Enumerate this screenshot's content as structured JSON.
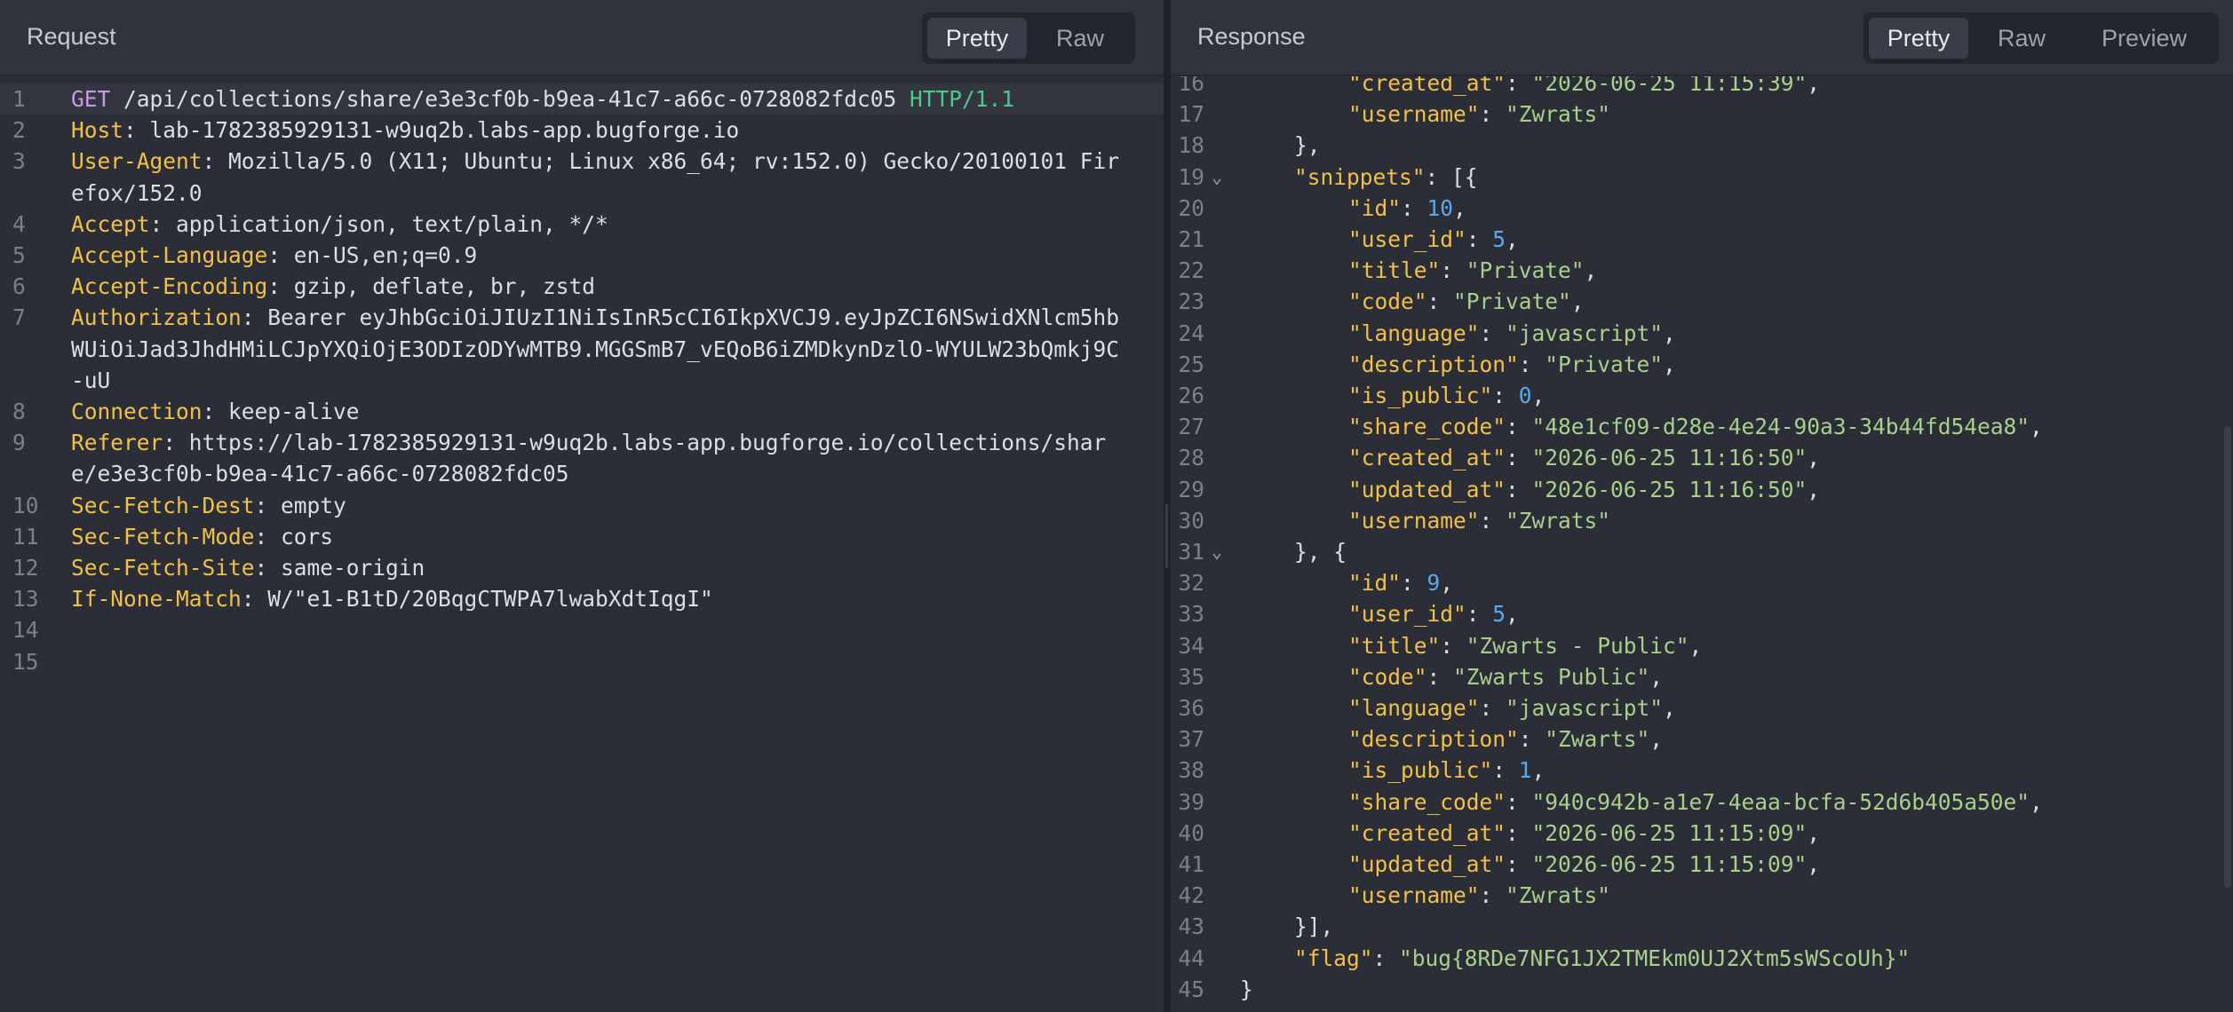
{
  "request": {
    "title": "Request",
    "tabs": [
      "Pretty",
      "Raw"
    ],
    "active_tab": "Pretty",
    "lines": [
      {
        "n": "1",
        "method": "GET",
        "path": " /api/collections/share/e3e3cf0b-b9ea-41c7-a66c-0728082fdc05 ",
        "proto": "HTTP/1.1"
      },
      {
        "n": "2",
        "key": "Host",
        "value": ": lab-1782385929131-w9uq2b.labs-app.bugforge.io"
      },
      {
        "n": "3",
        "key": "User-Agent",
        "value": ": Mozilla/5.0 (X11; Ubuntu; Linux x86_64; rv:152.0) Gecko/20100101 Fir",
        "cont": [
          "efox/152.0"
        ]
      },
      {
        "n": "4",
        "key": "Accept",
        "value": ": application/json, text/plain, */*"
      },
      {
        "n": "5",
        "key": "Accept-Language",
        "value": ": en-US,en;q=0.9"
      },
      {
        "n": "6",
        "key": "Accept-Encoding",
        "value": ": gzip, deflate, br, zstd"
      },
      {
        "n": "7",
        "key": "Authorization",
        "value": ": Bearer eyJhbGciOiJIUzI1NiIsInR5cCI6IkpXVCJ9.eyJpZCI6NSwidXNlcm5hb",
        "cont": [
          "WUiOiJad3JhdHMiLCJpYXQiOjE3ODIzODYwMTB9.MGGSmB7_vEQoB6iZMDkynDzlO-WYULW23bQmkj9C",
          "-uU"
        ]
      },
      {
        "n": "8",
        "key": "Connection",
        "value": ": keep-alive"
      },
      {
        "n": "9",
        "key": "Referer",
        "value": ": https://lab-1782385929131-w9uq2b.labs-app.bugforge.io/collections/shar",
        "cont": [
          "e/e3e3cf0b-b9ea-41c7-a66c-0728082fdc05"
        ]
      },
      {
        "n": "10",
        "key": "Sec-Fetch-Dest",
        "value": ": empty"
      },
      {
        "n": "11",
        "key": "Sec-Fetch-Mode",
        "value": ": cors"
      },
      {
        "n": "12",
        "key": "Sec-Fetch-Site",
        "value": ": same-origin"
      },
      {
        "n": "13",
        "key": "If-None-Match",
        "value": ": W/\"e1-B1tD/20BqgCTWPA7lwabXdtIqgI\""
      },
      {
        "n": "14"
      },
      {
        "n": "15"
      }
    ]
  },
  "response": {
    "title": "Response",
    "tabs": [
      "Pretty",
      "Raw",
      "Preview"
    ],
    "active_tab": "Pretty",
    "lines": [
      {
        "n": "16",
        "indent": 2,
        "tokens": [
          [
            "k",
            "\"created_at\""
          ],
          [
            "p",
            ": "
          ],
          [
            "s",
            "\"2026-06-25 11:15:39\""
          ],
          [
            "p",
            ","
          ]
        ]
      },
      {
        "n": "17",
        "indent": 2,
        "tokens": [
          [
            "k",
            "\"username\""
          ],
          [
            "p",
            ": "
          ],
          [
            "s",
            "\"Zwrats\""
          ]
        ]
      },
      {
        "n": "18",
        "indent": 1,
        "tokens": [
          [
            "p",
            "},"
          ]
        ]
      },
      {
        "n": "19",
        "indent": 1,
        "fold": true,
        "tokens": [
          [
            "k",
            "\"snippets\""
          ],
          [
            "p",
            ": [{"
          ]
        ]
      },
      {
        "n": "20",
        "indent": 2,
        "tokens": [
          [
            "k",
            "\"id\""
          ],
          [
            "p",
            ": "
          ],
          [
            "n",
            "10"
          ],
          [
            "p",
            ","
          ]
        ]
      },
      {
        "n": "21",
        "indent": 2,
        "tokens": [
          [
            "k",
            "\"user_id\""
          ],
          [
            "p",
            ": "
          ],
          [
            "n",
            "5"
          ],
          [
            "p",
            ","
          ]
        ]
      },
      {
        "n": "22",
        "indent": 2,
        "tokens": [
          [
            "k",
            "\"title\""
          ],
          [
            "p",
            ": "
          ],
          [
            "s",
            "\"Private\""
          ],
          [
            "p",
            ","
          ]
        ]
      },
      {
        "n": "23",
        "indent": 2,
        "tokens": [
          [
            "k",
            "\"code\""
          ],
          [
            "p",
            ": "
          ],
          [
            "s",
            "\"Private\""
          ],
          [
            "p",
            ","
          ]
        ]
      },
      {
        "n": "24",
        "indent": 2,
        "tokens": [
          [
            "k",
            "\"language\""
          ],
          [
            "p",
            ": "
          ],
          [
            "s",
            "\"javascript\""
          ],
          [
            "p",
            ","
          ]
        ]
      },
      {
        "n": "25",
        "indent": 2,
        "tokens": [
          [
            "k",
            "\"description\""
          ],
          [
            "p",
            ": "
          ],
          [
            "s",
            "\"Private\""
          ],
          [
            "p",
            ","
          ]
        ]
      },
      {
        "n": "26",
        "indent": 2,
        "tokens": [
          [
            "k",
            "\"is_public\""
          ],
          [
            "p",
            ": "
          ],
          [
            "n",
            "0"
          ],
          [
            "p",
            ","
          ]
        ]
      },
      {
        "n": "27",
        "indent": 2,
        "tokens": [
          [
            "k",
            "\"share_code\""
          ],
          [
            "p",
            ": "
          ],
          [
            "s",
            "\"48e1cf09-d28e-4e24-90a3-34b44fd54ea8\""
          ],
          [
            "p",
            ","
          ]
        ]
      },
      {
        "n": "28",
        "indent": 2,
        "tokens": [
          [
            "k",
            "\"created_at\""
          ],
          [
            "p",
            ": "
          ],
          [
            "s",
            "\"2026-06-25 11:16:50\""
          ],
          [
            "p",
            ","
          ]
        ]
      },
      {
        "n": "29",
        "indent": 2,
        "tokens": [
          [
            "k",
            "\"updated_at\""
          ],
          [
            "p",
            ": "
          ],
          [
            "s",
            "\"2026-06-25 11:16:50\""
          ],
          [
            "p",
            ","
          ]
        ]
      },
      {
        "n": "30",
        "indent": 2,
        "tokens": [
          [
            "k",
            "\"username\""
          ],
          [
            "p",
            ": "
          ],
          [
            "s",
            "\"Zwrats\""
          ]
        ]
      },
      {
        "n": "31",
        "indent": 1,
        "fold": true,
        "tokens": [
          [
            "p",
            "}, {"
          ]
        ]
      },
      {
        "n": "32",
        "indent": 2,
        "tokens": [
          [
            "k",
            "\"id\""
          ],
          [
            "p",
            ": "
          ],
          [
            "n",
            "9"
          ],
          [
            "p",
            ","
          ]
        ]
      },
      {
        "n": "33",
        "indent": 2,
        "tokens": [
          [
            "k",
            "\"user_id\""
          ],
          [
            "p",
            ": "
          ],
          [
            "n",
            "5"
          ],
          [
            "p",
            ","
          ]
        ]
      },
      {
        "n": "34",
        "indent": 2,
        "tokens": [
          [
            "k",
            "\"title\""
          ],
          [
            "p",
            ": "
          ],
          [
            "s",
            "\"Zwarts - Public\""
          ],
          [
            "p",
            ","
          ]
        ]
      },
      {
        "n": "35",
        "indent": 2,
        "tokens": [
          [
            "k",
            "\"code\""
          ],
          [
            "p",
            ": "
          ],
          [
            "s",
            "\"Zwarts Public\""
          ],
          [
            "p",
            ","
          ]
        ]
      },
      {
        "n": "36",
        "indent": 2,
        "tokens": [
          [
            "k",
            "\"language\""
          ],
          [
            "p",
            ": "
          ],
          [
            "s",
            "\"javascript\""
          ],
          [
            "p",
            ","
          ]
        ]
      },
      {
        "n": "37",
        "indent": 2,
        "tokens": [
          [
            "k",
            "\"description\""
          ],
          [
            "p",
            ": "
          ],
          [
            "s",
            "\"Zwarts\""
          ],
          [
            "p",
            ","
          ]
        ]
      },
      {
        "n": "38",
        "indent": 2,
        "tokens": [
          [
            "k",
            "\"is_public\""
          ],
          [
            "p",
            ": "
          ],
          [
            "n",
            "1"
          ],
          [
            "p",
            ","
          ]
        ]
      },
      {
        "n": "39",
        "indent": 2,
        "tokens": [
          [
            "k",
            "\"share_code\""
          ],
          [
            "p",
            ": "
          ],
          [
            "s",
            "\"940c942b-a1e7-4eaa-bcfa-52d6b405a50e\""
          ],
          [
            "p",
            ","
          ]
        ]
      },
      {
        "n": "40",
        "indent": 2,
        "tokens": [
          [
            "k",
            "\"created_at\""
          ],
          [
            "p",
            ": "
          ],
          [
            "s",
            "\"2026-06-25 11:15:09\""
          ],
          [
            "p",
            ","
          ]
        ]
      },
      {
        "n": "41",
        "indent": 2,
        "tokens": [
          [
            "k",
            "\"updated_at\""
          ],
          [
            "p",
            ": "
          ],
          [
            "s",
            "\"2026-06-25 11:15:09\""
          ],
          [
            "p",
            ","
          ]
        ]
      },
      {
        "n": "42",
        "indent": 2,
        "tokens": [
          [
            "k",
            "\"username\""
          ],
          [
            "p",
            ": "
          ],
          [
            "s",
            "\"Zwrats\""
          ]
        ]
      },
      {
        "n": "43",
        "indent": 1,
        "tokens": [
          [
            "p",
            "}],"
          ]
        ]
      },
      {
        "n": "44",
        "indent": 1,
        "tokens": [
          [
            "k",
            "\"flag\""
          ],
          [
            "p",
            ": "
          ],
          [
            "s",
            "\"bug{8RDe7NFG1JX2TMEkm0UJ2Xtm5sWScoUh}\""
          ]
        ]
      },
      {
        "n": "45",
        "indent": 0,
        "tokens": [
          [
            "p",
            "}"
          ]
        ]
      }
    ]
  }
}
